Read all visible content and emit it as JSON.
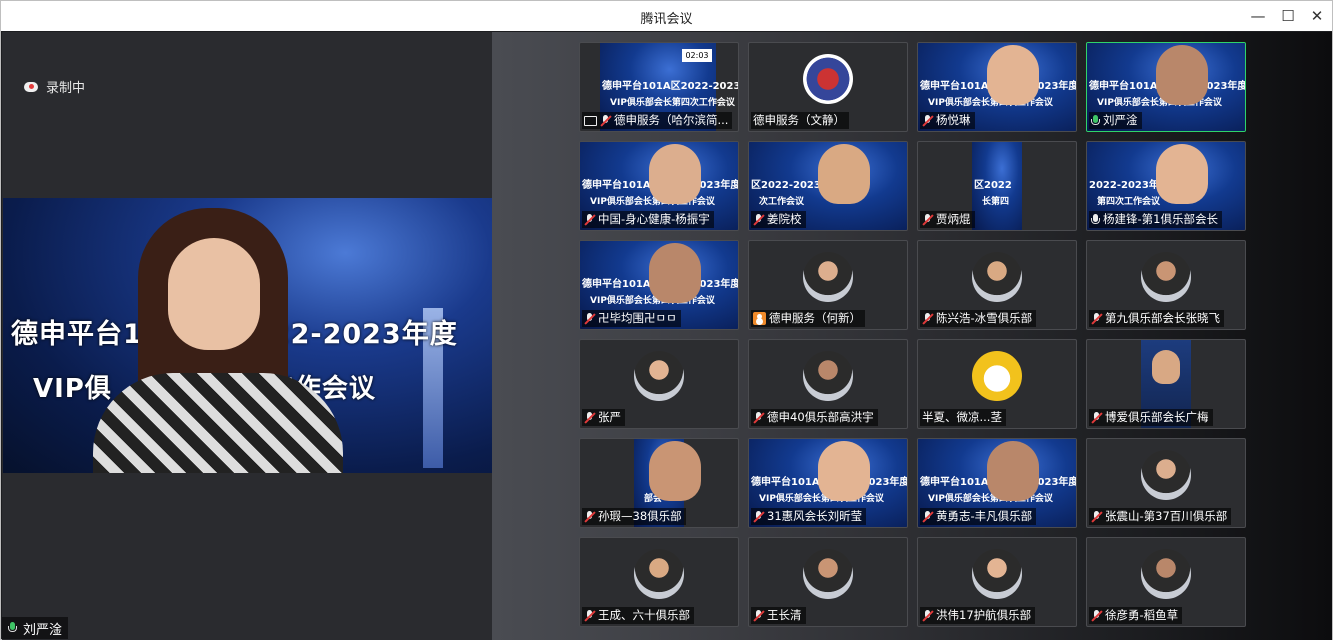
{
  "window": {
    "title": "腾讯会议",
    "minimize_icon": "minimize-icon",
    "maximize_icon": "maximize-icon",
    "close_icon": "close-icon"
  },
  "recording": {
    "label": "录制中",
    "icon": "cloud-record-icon"
  },
  "speaker": {
    "name": "刘严淦",
    "banner_line1": "德申平台1",
    "banner_line1b": "22-2023年度",
    "banner_line2": "VIP俱",
    "banner_line2b": "工作会议"
  },
  "tiles": [
    {
      "name": "德申服务（哈尔滨简...",
      "icon": "screen-share-icon",
      "kind": "banner-small",
      "timer": "02:03",
      "b1": "德申平台101A区2022-2023年度",
      "b2": "VIP俱乐部会长第四次工作会议"
    },
    {
      "name": "德申服务（文静）",
      "icon": "none",
      "kind": "avatar-logo"
    },
    {
      "name": "杨悦琳",
      "icon": "mic-off-icon",
      "kind": "banner-person",
      "b1": "德申平台101A区2022-2023年度",
      "b2": "VIP俱乐部会长第四次工作会议"
    },
    {
      "name": "刘严淦",
      "icon": "mic-on-icon",
      "kind": "banner-person",
      "active": true,
      "b1": "德申平台101A区2022-2023年度",
      "b2": "VIP俱乐部会长第四次工作会议"
    },
    {
      "name": "中国-身心健康-杨振宇",
      "icon": "mic-off-icon",
      "kind": "banner-person",
      "b1": "德申平台101A区2022-2023年度",
      "b2": "VIP俱乐部会长第四次工作会议"
    },
    {
      "name": "姜院校",
      "icon": "mic-off-icon",
      "kind": "banner-person",
      "b1": "区2022-2023年度",
      "b2": "次工作会议"
    },
    {
      "name": "贾炳焜",
      "icon": "mic-off-icon",
      "kind": "banner-narrow",
      "b1": "区2022",
      "b2": "长第四"
    },
    {
      "name": "杨建锋-第1俱乐部会长",
      "icon": "mic-white-icon",
      "kind": "banner-person",
      "b1": "2022-2023年度",
      "b2": "第四次工作会议"
    },
    {
      "name": "卍毕均围卍ㅁㅁ",
      "icon": "mic-off-icon",
      "kind": "banner-person",
      "b1": "德申平台101A区2022-2023年度",
      "b2": "VIP俱乐部会长第四次工作会议"
    },
    {
      "name": "德申服务（何新）",
      "icon": "user-icon",
      "kind": "avatar"
    },
    {
      "name": "陈兴浩-冰雪俱乐部",
      "icon": "mic-off-icon",
      "kind": "avatar"
    },
    {
      "name": "第九俱乐部会长张晓飞",
      "icon": "mic-off-icon",
      "kind": "avatar"
    },
    {
      "name": "张严",
      "icon": "mic-off-icon",
      "kind": "avatar"
    },
    {
      "name": "德申40俱乐部高洪宇",
      "icon": "mic-off-icon",
      "kind": "avatar"
    },
    {
      "name": "半夏、微凉...茎",
      "icon": "none",
      "kind": "avatar-cartoon"
    },
    {
      "name": "博爱俱乐部会长广梅",
      "icon": "mic-off-icon",
      "kind": "portrait-narrow"
    },
    {
      "name": "孙瑕—38俱乐部",
      "icon": "mic-off-icon",
      "kind": "banner-narrow",
      "b1": "",
      "b2": "部会"
    },
    {
      "name": "31惠风会长刘昕莹",
      "icon": "mic-off-icon",
      "kind": "banner-person",
      "b1": "德申平台101A区2022-2023年度",
      "b2": "VIP俱乐部会长第四次工作会议"
    },
    {
      "name": "黄勇志-丰凡俱乐部",
      "icon": "mic-off-icon",
      "kind": "banner-person",
      "b1": "德申平台101A区2022-2023年度",
      "b2": "VIP俱乐部会长第四次工作会议"
    },
    {
      "name": "张震山-第37百川俱乐部",
      "icon": "mic-off-icon",
      "kind": "avatar"
    },
    {
      "name": "王成、六十俱乐部",
      "icon": "mic-off-icon",
      "kind": "avatar"
    },
    {
      "name": "王长清",
      "icon": "mic-off-icon",
      "kind": "avatar"
    },
    {
      "name": "洪伟17护航俱乐部",
      "icon": "mic-off-icon",
      "kind": "avatar"
    },
    {
      "name": "徐彦勇-稻鱼草",
      "icon": "mic-off-icon",
      "kind": "avatar"
    }
  ]
}
